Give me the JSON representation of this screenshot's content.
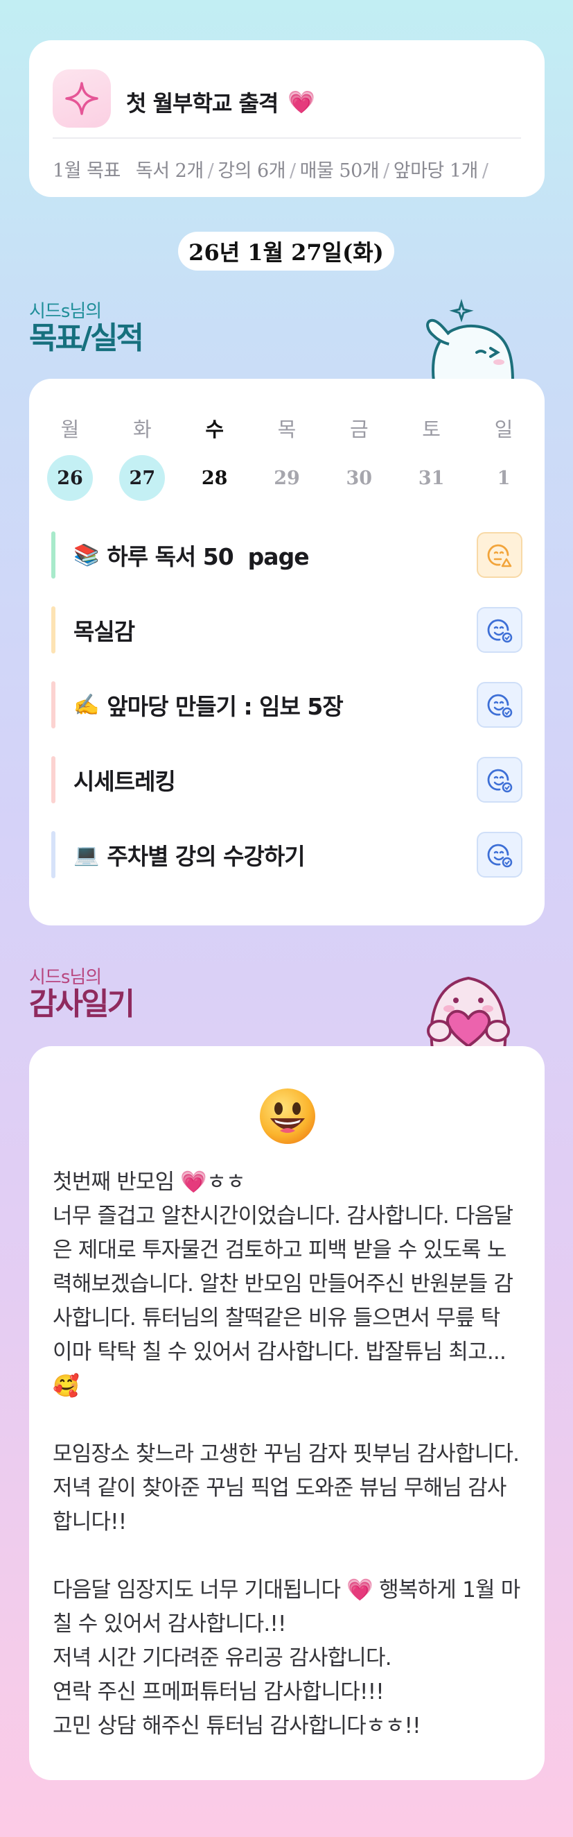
{
  "goal_card": {
    "title": "첫 월부학교 출격",
    "title_emoji": "💗",
    "icon": "sparkle-icon",
    "summary_prefix": "1월 목표",
    "summary_items": [
      "독서 2개",
      "강의 6개",
      "매물 50개",
      "앞마당 1개"
    ]
  },
  "date_pill": "26년 1월 27일(화)",
  "goals_section": {
    "subtitle": "시드s님의",
    "title": "목표/실적"
  },
  "week": {
    "weekdays": [
      "월",
      "화",
      "수",
      "목",
      "금",
      "토",
      "일"
    ],
    "dates": [
      "26",
      "27",
      "28",
      "29",
      "30",
      "31",
      "1"
    ],
    "done_indices": [
      0,
      1
    ],
    "today_index": 2
  },
  "goals": [
    {
      "emoji": "📚",
      "label": "하루 독서 50  page",
      "bar_color": "#a8eacb",
      "status": "warn",
      "status_icon": "face-warning-icon"
    },
    {
      "emoji": "",
      "label": "목실감",
      "bar_color": "#fde3b4",
      "status": "ok",
      "status_icon": "face-check-icon"
    },
    {
      "emoji": "✍️",
      "label": "앞마당 만들기 : 임보 5장",
      "bar_color": "#fcd3d1",
      "status": "ok",
      "status_icon": "face-check-icon"
    },
    {
      "emoji": "",
      "label": "시세트레킹",
      "bar_color": "#fcd3d1",
      "status": "ok",
      "status_icon": "face-check-icon"
    },
    {
      "emoji": "💻",
      "label": "주차별 강의 수강하기",
      "bar_color": "#d6e2f9",
      "status": "ok",
      "status_icon": "face-check-icon"
    }
  ],
  "colors": {
    "accent_teal": "#16707e",
    "accent_pink": "#8f2a5e",
    "done_circle": "#c4f0f4",
    "heart": "#ec3c93"
  },
  "thanks_section": {
    "subtitle": "시드s님의",
    "title": "감사일기"
  },
  "thanks_paragraphs": [
    "첫번째 반모임 💗ㅎㅎ",
    "너무 즐겁고 알찬시간이었습니다. 감사합니다. 다음달은 제대로 투자물건 검토하고 피백 받을 수 있도록 노력해보겠습니다. 알찬 반모임 만들어주신 반원분들 감사합니다. 튜터님의 찰떡같은 비유 들으면서 무릎 탁 이마 탁탁 칠 수 있어서 감사합니다. 밥잘튜님 최고... 🥰",
    "",
    "모임장소 찾느라 고생한 꾸님 감자 핏부님 감사합니다. 저녁 같이 찾아준 꾸님 픽업 도와준 뷰님 무해님 감사합니다!!",
    "",
    "다음달 임장지도 너무 기대됩니다 💗 행복하게 1월 마칠 수 있어서 감사합니다.!!",
    "저녁 시간 기다려준 유리공 감사합니다.",
    "연락 주신 프메퍼튜터님 감사합니다!!!",
    "고민 상담 해주신 튜터님 감사합니다ㅎㅎ!!"
  ]
}
